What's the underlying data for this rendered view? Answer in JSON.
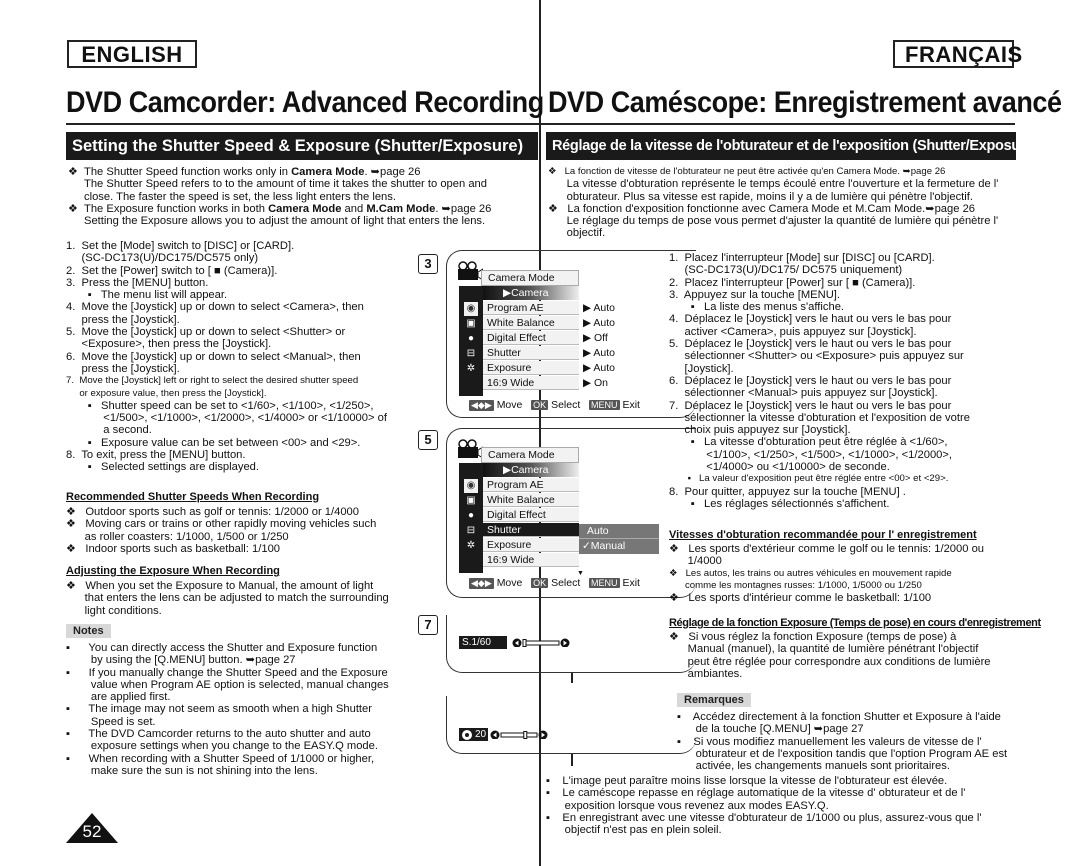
{
  "english": {
    "lang_label": "ENGLISH",
    "page_title": "DVD Camcorder: Advanced Recording",
    "section_title": "Setting the Shutter Speed & Exposure (Shutter/Exposure)",
    "intro": [
      {
        "l1": "The Shutter Speed function works only in ",
        "b1": "Camera Mode",
        "l1b": ". ➥page 26"
      },
      {
        "plain": "The Shutter Speed refers to to the amount of time it takes the shutter to open and"
      },
      {
        "plain": "close. The faster the speed is set, the less light enters the lens."
      },
      {
        "l1": "The Exposure function works in both ",
        "b1": "Camera Mode",
        "mid": " and ",
        "b2": "M.Cam Mode",
        "l1b": ". ➥page 26"
      },
      {
        "plain": "Setting the Exposure allows you to adjust the amount of light that enters the lens."
      }
    ],
    "steps": [
      "1.  Set the [Mode] switch to [DISC] or [CARD].",
      "     (SC-DC173(U)/DC175/DC575 only)",
      "2.  Set the [Power] switch to [ ■ (Camera)].",
      "3.  Press the [MENU] button.",
      "       ▪   The menu list will appear.",
      "4.  Move the [Joystick] up or down to select <Camera>, then",
      "     press the [Joystick].",
      "5.  Move the [Joystick] up or down to select <Shutter> or",
      "     <Exposure>, then press the [Joystick].",
      "6.  Move the [Joystick] up or down to select <Manual>, then",
      "     press the [Joystick].",
      "7.  Move the [Joystick] left or right to select the desired shutter speed",
      "     or exposure value, then press the [Joystick].",
      "       ▪   Shutter speed can be set to <1/60>, <1/100>, <1/250>,",
      "            <1/500>, <1/1000>, <1/2000>, <1/4000> or <1/10000> of",
      "            a second.",
      "       ▪   Exposure value can be set between <00> and <29>.",
      "8.  To exit, press the [MENU] button.",
      "       ▪   Selected settings are displayed."
    ],
    "recommended_heading": "Recommended Shutter Speeds When Recording",
    "recommended": [
      "❖   Outdoor sports such as golf or tennis: 1/2000 or 1/4000",
      "❖   Moving cars or trains or other rapidly moving vehicles such",
      "      as roller coasters: 1/1000, 1/500 or 1/250",
      "❖   Indoor sports such as basketball: 1/100"
    ],
    "exposure_heading": "Adjusting the Exposure When Recording",
    "exposure": [
      "❖   When you set the Exposure to Manual, the amount of light",
      "      that enters the lens can be adjusted to match the surrounding",
      "      light conditions."
    ],
    "notes_label": "Notes",
    "notes": [
      "▪      You can directly access the Shutter and Exposure function",
      "        by using the [Q.MENU] button. ➥page 27",
      "▪      If you manually change the Shutter Speed and the Exposure",
      "        value when Program AE option is selected, manual changes",
      "        are applied first.",
      "▪      The image may not seem as smooth when a high Shutter",
      "        Speed is set.",
      "▪      The DVD Camcorder returns to the auto shutter and auto",
      "        exposure settings when you change to the EASY.Q mode.",
      "▪      When recording with a Shutter Speed of 1/1000 or higher,",
      "        make sure the sun is not shining into the lens."
    ],
    "page_number": "52"
  },
  "screens": {
    "step3": {
      "step": "3",
      "header": "Camera Mode",
      "submenu_title": "▶Camera",
      "items": [
        {
          "label": "Program AE",
          "value": "▶ Auto"
        },
        {
          "label": "White Balance",
          "value": "▶ Auto"
        },
        {
          "label": "Digital Effect",
          "value": "▶ Off"
        },
        {
          "label": "Shutter",
          "value": "▶ Auto"
        },
        {
          "label": "Exposure",
          "value": "▶ Auto"
        },
        {
          "label": "16:9 Wide",
          "value": "▶ On"
        }
      ],
      "footer": {
        "move_chip": "◀◆▶",
        "move": "Move",
        "ok_chip": "OK",
        "select": "Select",
        "menu_chip": "MENU",
        "exit": "Exit"
      }
    },
    "step5": {
      "step": "5",
      "header": "Camera Mode",
      "submenu_title": "▶Camera",
      "items": [
        {
          "label": "Program AE"
        },
        {
          "label": "White Balance"
        },
        {
          "label": "Digital Effect"
        },
        {
          "label": "Shutter",
          "selected": true
        },
        {
          "label": "Exposure"
        },
        {
          "label": "16:9 Wide"
        }
      ],
      "options": [
        "Auto",
        "✓Manual"
      ],
      "footer": {
        "move_chip": "◀◆▶",
        "move": "Move",
        "ok_chip": "OK",
        "select": "Select",
        "menu_chip": "MENU",
        "exit": "Exit"
      }
    },
    "step7": {
      "step": "7",
      "shutter_label": "S.1/60",
      "shutter_slider_position": 0.0,
      "exposure_label": "20",
      "exposure_slider_position": 0.69
    }
  },
  "french": {
    "lang_label": "FRANÇAIS",
    "page_title": "DVD Caméscope: Enregistrement avancé",
    "section_title": "Réglage de la vitesse de l'obturateur et de l'exposition (Shutter/Exposure)",
    "intro": [
      "❖   La fonction de vitesse de l'obturateur ne peut être activée qu'en Camera Mode. ➥page 26",
      "      La vitesse d'obturation représente le temps écoulé entre l'ouverture et la fermeture de l'",
      "      obturateur. Plus sa vitesse est rapide, moins il y a de lumière qui pénètre l'objectif.",
      "❖   La fonction d'exposition fonctionne avec Camera Mode et M.Cam Mode.➥page 26",
      "      Le réglage du temps de pose vous permet d'ajuster la quantité de lumière qui pénètre l'",
      "      objectif."
    ],
    "steps": [
      "1.  Placez l'interrupteur [Mode] sur [DISC] ou [CARD].",
      "     (SC-DC173(U)/DC175/ DC575 uniquement)",
      "2.  Placez l'interrupteur [Power] sur [ ■ (Camera)].",
      "3.  Appuyez sur la touche [MENU].",
      "       ▪   La liste des menus s'affiche.",
      "4.  Déplacez le [Joystick] vers le haut ou vers le bas pour",
      "     activer <Camera>, puis appuyez sur [Joystick].",
      "5.  Déplacez le [Joystick] vers le haut ou vers le bas pour",
      "     sélectionner <Shutter> ou <Exposure> puis appuyez sur",
      "     [Joystick].",
      "6.  Déplacez le [Joystick] vers le haut ou vers le bas pour",
      "     sélectionner <Manual> puis appuyez sur [Joystick].",
      "7.  Déplacez le [Joystick] vers le haut ou vers le bas pour",
      "     sélectionner la vitesse d'obturation et l'exposition de votre",
      "     choix puis appuyez sur [Joystick].",
      "       ▪   La vitesse d'obturation peut être réglée à <1/60>,",
      "            <1/100>, <1/250>, <1/500>, <1/1000>, <1/2000>,",
      "            <1/4000> ou <1/10000> de seconde.",
      "       ▪   La valeur d'exposition peut être réglée entre <00> et <29>.",
      "8.  Pour quitter, appuyez sur la touche [MENU] .",
      "       ▪   Les réglages sélectionnés s'affichent."
    ],
    "recommended_heading": "Vitesses d'obturation recommandée pour l' enregistrement",
    "recommended": [
      "❖   Les sports d'extérieur comme le golf ou le tennis: 1/2000 ou",
      "      1/4000",
      "❖   Les autos, les trains ou autres véhicules en mouvement rapide",
      "      comme les montagnes russes: 1/1000, 1/5000 ou 1/250",
      "❖   Les sports d'intérieur comme le basketball: 1/100"
    ],
    "exposure_heading": "Réglage de la fonction Exposure (Temps de pose) en cours d'enregistrement",
    "exposure": [
      "❖   Si vous réglez la fonction Exposure (temps de pose) à",
      "      Manual (manuel), la quantité de lumière pénétrant l'objectif",
      "      peut être réglée pour correspondre aux conditions de lumière",
      "      ambiantes."
    ],
    "notes_label": "Remarques",
    "notes_right": [
      "▪    Accédez directement à la fonction Shutter et Exposure à l'aide",
      "      de la touche [Q.MENU] ➥page 27",
      "▪    Si vous modifiez manuellement les valeurs de vitesse de l'",
      "      obturateur et de l'exposition tandis que l'option Program AE est",
      "      activée, les changements manuels sont prioritaires."
    ],
    "notes_bottom": [
      "▪    L'image peut paraître moins lisse lorsque la vitesse de l'obturateur est élevée.",
      "▪    Le caméscope repasse en réglage automatique de la vitesse d' obturateur et de l'",
      "      exposition lorsque vous revenez aux modes EASY.Q.",
      "▪    En enregistrant avec une vitesse d'obturateur de 1/1000 ou plus, assurez-vous que l'",
      "      objectif n'est pas en plein soleil."
    ]
  }
}
